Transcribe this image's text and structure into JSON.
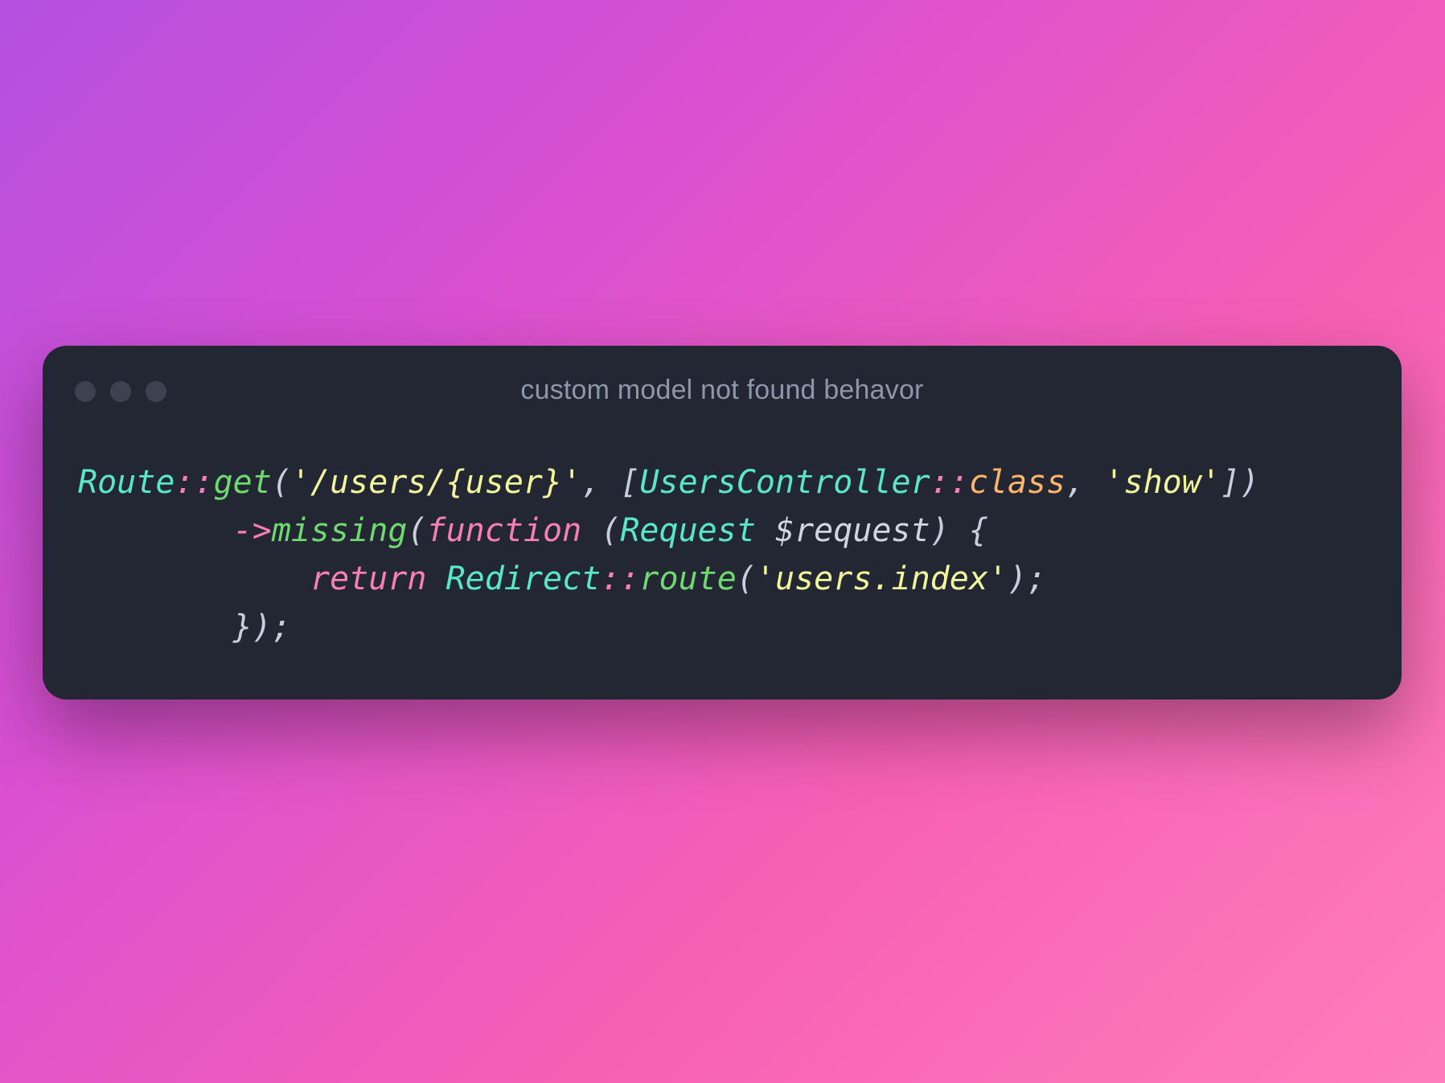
{
  "window": {
    "title": "custom model not found behavor"
  },
  "code": {
    "t_route": "Route",
    "t_dcolon1": "::",
    "t_get": "get",
    "t_open1": "(",
    "t_str_path": "'/users/{user}'",
    "t_comma1": ", ",
    "t_lbrack": "[",
    "t_uc": "UsersController",
    "t_dcolon2": "::",
    "t_class": "class",
    "t_comma2": ", ",
    "t_str_show": "'show'",
    "t_rbrack": "]",
    "t_close1": ")",
    "t_indent2": "        ",
    "t_arrow": "->",
    "t_missing": "missing",
    "t_open2": "(",
    "t_function": "function",
    "t_sp1": " ",
    "t_open3": "(",
    "t_request": "Request",
    "t_sp2": " ",
    "t_var": "$request",
    "t_close3": ")",
    "t_sp3": " ",
    "t_lbrace": "{",
    "t_indent3": "            ",
    "t_return": "return",
    "t_sp4": " ",
    "t_redirect": "Redirect",
    "t_dcolon3": "::",
    "t_routem": "route",
    "t_open4": "(",
    "t_str_idx": "'users.index'",
    "t_close4": ")",
    "t_semi1": ";",
    "t_indent4": "        ",
    "t_rbrace": "}",
    "t_close2": ")",
    "t_semi2": ";"
  },
  "colors": {
    "window_bg": "#232734",
    "title_fg": "#8e97a9",
    "dot": "#3d4250",
    "class": "#58e7c9",
    "operator": "#f77fb2",
    "method": "#6fd96f",
    "string": "#f2f59a",
    "punct": "#c7cedd",
    "keyword": "#f77fb2",
    "attr": "#ffb468",
    "var": "#cfd5e1"
  }
}
